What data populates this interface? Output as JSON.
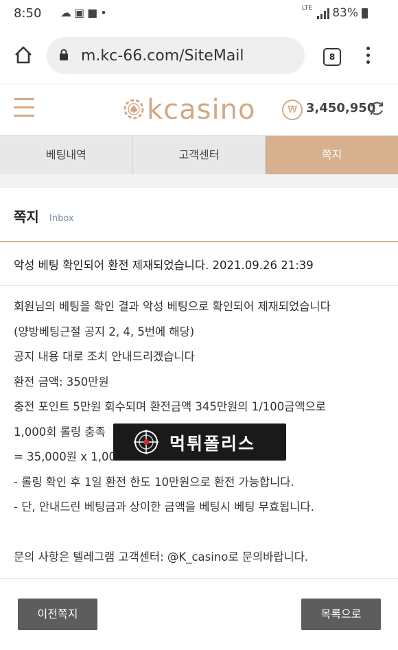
{
  "status_bar": {
    "time": "8:50",
    "notification_icons": [
      "cloud-icon",
      "image-icon",
      "chat-icon",
      "dot-icon"
    ],
    "network": "LTE",
    "battery": "83%"
  },
  "browser": {
    "url": "m.kc-66.com/SiteMail",
    "tab_count": "8"
  },
  "site": {
    "logo_text": "kcasino",
    "balance": "3,450,950",
    "currency_symbol": "₩",
    "brand_color": "#d6b08f"
  },
  "nav": {
    "tabs": [
      {
        "label": "베팅내역",
        "active": false
      },
      {
        "label": "고객센터",
        "active": false
      },
      {
        "label": "쪽지",
        "active": true
      }
    ]
  },
  "inbox": {
    "title": "쪽지",
    "subtitle": "Inbox",
    "subject": "악성 베팅 확인되어 환전 제재되었습니다. 2021.09.26 21:39",
    "body": [
      "회원님의 베팅을 확인 결과 악성 베팅으로 확인되어 제재되었습니다",
      "(양방베팅근절 공지 2, 4, 5번에 해당)",
      "공지 내용 대로 조치 안내드리겠습니다",
      "환전 금액: 350만원",
      "충전 포인트 5만원 회수되며 환전금액 345만원의 1/100금액으로",
      "1,000회 롤링 충족",
      "= 35,000원 x 1,000",
      "- 롤링 확인 후 1일 환전 한도 10만원으로 환전 가능합니다.",
      "- 단, 안내드린 베팅금과 상이한 금액을 베팅시 베팅 무효됩니다.",
      "",
      "문의 사항은 텔레그램 고객센터: @K_casino로 문의바랍니다."
    ]
  },
  "watermark": {
    "text": "먹튀폴리스"
  },
  "buttons": {
    "prev": "이전쪽지",
    "list": "목록으로"
  }
}
